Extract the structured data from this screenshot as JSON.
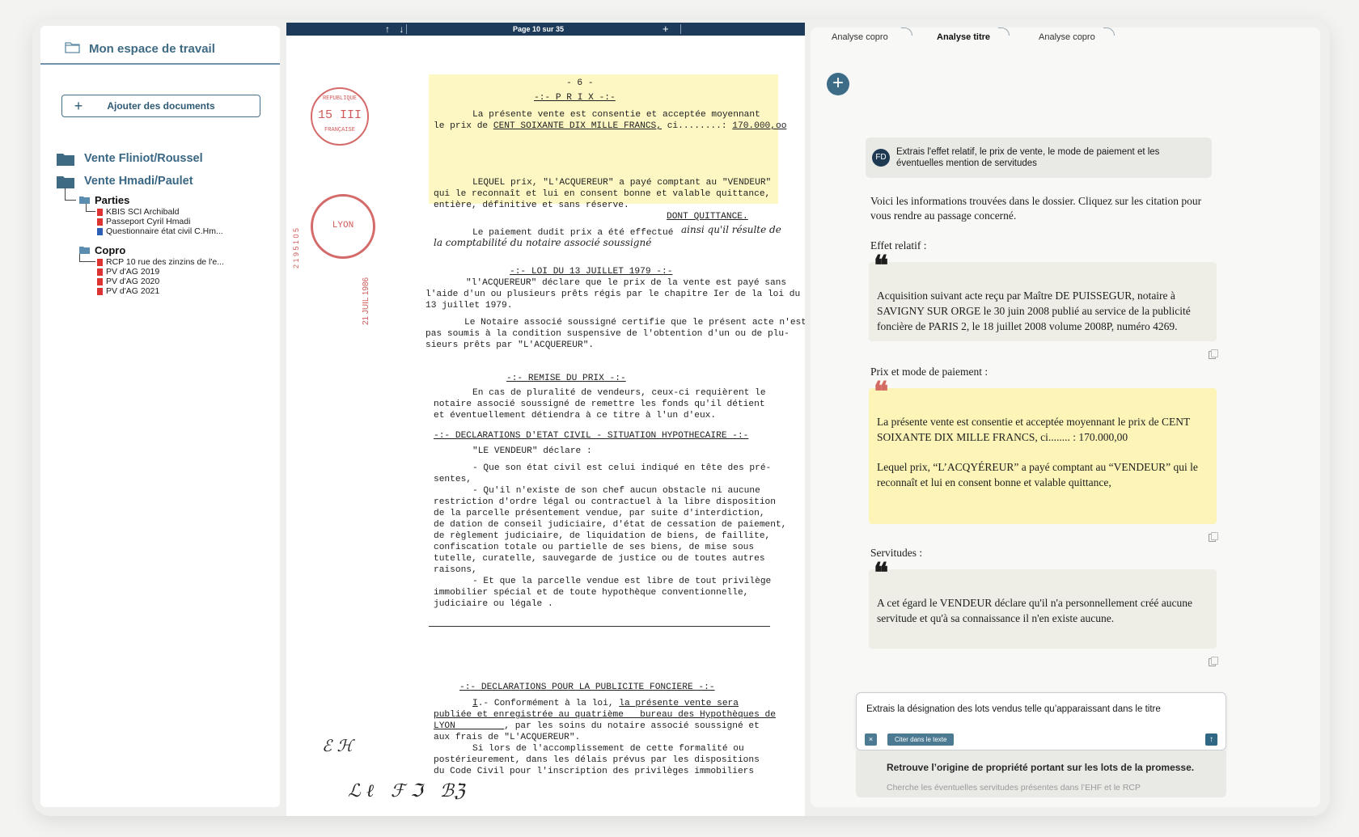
{
  "sidebar": {
    "workspace_title": "Mon espace de travail",
    "add_documents": "Ajouter des documents",
    "folders": [
      {
        "name": "Vente Fliniot/Roussel"
      },
      {
        "name": "Vente Hmadi/Paulet",
        "subfolders": [
          {
            "name": "Parties",
            "files": [
              "KBIS SCI Archibald",
              "Passeport Cyril Hmadi",
              "Questionnaire état civil C.Hm..."
            ]
          },
          {
            "name": "Copro",
            "files": [
              "RCP 10 rue des zinzins de l'e...",
              "PV d'AG 2019",
              "PV d'AG 2020",
              "PV d'AG 2021"
            ]
          }
        ]
      }
    ]
  },
  "viewer": {
    "arrows": "↑ ↓",
    "page_indicator": "Page 10 sur 35",
    "zoom_plus": "+",
    "doc": {
      "page_num": "- 6 -",
      "prix_title": "-:- P R I X -:-",
      "prix_l1": "La présente vente est consentie et acceptée moyennant",
      "prix_l2a": "le prix de ",
      "prix_l2b": "CENT SOIXANTE DIX MILLE FRANCS,",
      "prix_l2c": " ci........: ",
      "prix_l2d": "170.000,oo",
      "lequel_l1": "LEQUEL prix, \"L'ACQUEREUR\" a payé comptant au \"VENDEUR\"",
      "lequel_l2": "qui le reconnaît et lui en consent bonne et valable quittance,",
      "lequel_l3": "entière, définitive et sans réserve.",
      "dont": "DONT QUITTANCE.",
      "paiement": "Le paiement dudit prix a été effectué",
      "hand1": "ainsi qu'il résulte de",
      "hand2": "la comptabilité du notaire associé soussigné",
      "loi_title": "-:- LOI DU 13 JUILLET 1979 -:-",
      "loi_l1": "\"l'ACQUEREUR\" déclare que le prix de la vente est payé sans",
      "loi_l2": "l'aide d'un ou plusieurs prêts régis par le chapitre Ier de la loi du",
      "loi_l3": "13 juillet 1979.",
      "not_l1": "Le Notaire associé soussigné certifie que le présent acte n'est",
      "not_l2": "pas soumis à la condition suspensive de l'obtention d'un ou de plu-",
      "not_l3": "sieurs prêts par \"L'ACQUEREUR\".",
      "remise_title": "-:- REMISE DU PRIX -:-",
      "remise_l1": "En cas de pluralité de vendeurs, ceux-ci requièrent le",
      "remise_l2": "notaire associé soussigné de remettre les fonds qu'il détient",
      "remise_l3": "et éventuellement détiendra à ce titre à l'un d'eux.",
      "decl_title": "-:- DECLARATIONS D'ETAT CIVIL - SITUATION HYPOTHECAIRE -:-",
      "vendeur_declare": "\"LE VENDEUR\" déclare :",
      "decl_l1": "- Que son état civil est celui indiqué en tête des pré-",
      "decl_l2": "sentes,",
      "decl_l3": "- Qu'il n'existe de son chef aucun obstacle ni aucune",
      "decl_l4": "restriction d'ordre légal ou contractuel à la libre disposition",
      "decl_l5": "de la parcelle présentement vendue, par suite d'interdiction,",
      "decl_l6": "de dation de conseil judiciaire, d'état de cessation de paiement,",
      "decl_l7": "de règlement judiciaire, de liquidation de biens, de faillite,",
      "decl_l8": "confiscation totale ou partielle de ses biens, de mise sous",
      "decl_l9": "tutelle, curatelle, sauvegarde de justice ou de toutes autres",
      "decl_l10": "raisons,",
      "decl_l11": "- Et que la parcelle vendue est libre de tout privilège",
      "decl_l12": "immobilier spécial et de toute hypothèque conventionnelle,",
      "decl_l13": "judiciaire ou légale .",
      "pub_title": "-:- DECLARATIONS POUR LA PUBLICITE FONCIERE -:-",
      "pub_l1a": "I",
      "pub_l1b": ".- Conformément à la loi, ",
      "pub_l1c": "la présente vente sera",
      "pub_l2": "publiée et enregistrée au quatrième   bureau des Hypothèques de",
      "pub_l3a": "LYON         ",
      "pub_l3b": ", par les soins du notaire associé soussigné et",
      "pub_l4": "aux frais de \"L'ACQUEREUR\".",
      "pub_l5": "Si lors de l'accomplissement de cette formalité ou",
      "pub_l6": "postérieurement, dans les délais prévus par les dispositions",
      "pub_l7": "du Code Civil pour l'inscription des privilèges immobiliers",
      "stamp1": "15 III",
      "stamp1_top": "REPUBLIQUE",
      "stamp1_side": "FRANÇAISE",
      "stamp2": "LYON",
      "red_date": "21 JUIL 1986",
      "red_num": "2 1 9 5 1 0 5",
      "initials": "ℰ ℋ",
      "signatures": "ℒ ℓ   ℱ ℑ   ℬℨ"
    }
  },
  "right_panel": {
    "tabs": [
      "Analyse copro",
      "Analyse titre",
      "Analyse copro"
    ],
    "active_tab": 1,
    "user": {
      "initials": "FD",
      "message": "Extrais l'effet relatif, le prix de vente, le mode de paiement et les éventuelles mention de servitudes"
    },
    "intro": "Voici les informations trouvées dans le dossier. Cliquez sur les citation pour vous rendre au passage concerné.",
    "effet_label": "Effet relatif :",
    "effet_quote": "Acquisition suivant acte reçu par Maître DE PUISSEGUR, notaire à SAVIGNY SUR ORGE le 30 juin 2008 publié au service de la publicité foncière de PARIS 2, le 18 juillet 2008 volume 2008P, numéro 4269.",
    "prix_label": "Prix et mode de paiement :",
    "prix_quote_1": "La présente vente est consentie et acceptée moyennant le prix de CENT SOIXANTE DIX MILLE FRANCS, ci........ : 170.000,00",
    "prix_quote_2": "Lequel prix, “L’ACQYÉREUR” a payé comptant au “VENDEUR” qui le reconnaît et lui en consent bonne et valable quittance,",
    "serv_label": "Servitudes :",
    "serv_quote": "A cet égard le VENDEUR déclare qu'il n'a personnellement créé aucune servitude et qu'à sa connaissance il n'en existe aucune.",
    "quote_mark": "❝",
    "input_value": "Extrais la désignation des lots vendus telle qu’apparaissant dans le titre",
    "clear_chip": "×",
    "cite_chip": "Citer dans le texte",
    "send": "↑",
    "suggestion_1": "Retrouve l’origine de propriété portant sur les lots de la promesse.",
    "suggestion_2": "Cherche les éventuelles servitudes présentes dans l’EHF et le RCP"
  },
  "colors": {
    "accent": "#3d6d86",
    "highlight": "#fdf7c3",
    "viewer_bar": "#1d3a5a"
  }
}
